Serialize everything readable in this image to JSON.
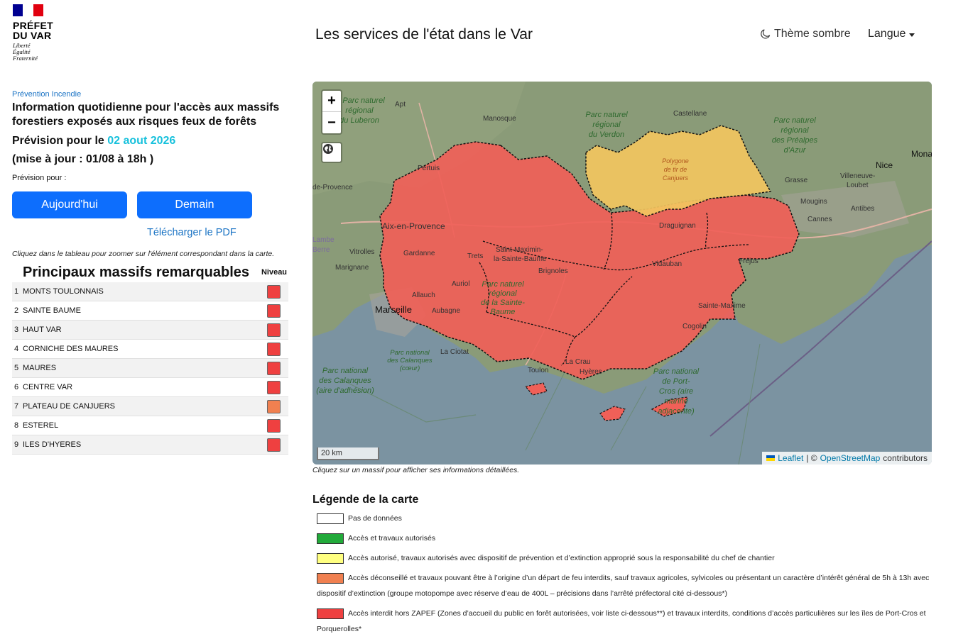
{
  "logo": {
    "line1": "PRÉFET",
    "line2": "DU VAR",
    "motto1": "Liberté",
    "motto2": "Égalité",
    "motto3": "Fraternité",
    "flag_colors": [
      "#000091",
      "#ffffff",
      "#e1000f"
    ]
  },
  "header": {
    "title": "Les services de l'état dans le Var",
    "theme_label": "Thème sombre",
    "theme_icon": "moon-icon",
    "lang_label": "Langue"
  },
  "prevention": {
    "category": "Prévention Incendie",
    "title": "Information quotidienne pour l'accès aux massifs forestiers exposés aux risques feux de forêts",
    "forecast_prefix": "Prévision pour le",
    "forecast_date": "02 aout 2026",
    "update": "(mise à jour : 01/08 à 18h )",
    "forecast_label": "Prévision pour :",
    "btn_today": "Aujourd'hui",
    "btn_tomorrow": "Demain",
    "pdf_link": "Télécharger le PDF",
    "hint": "Cliquez dans le tableau pour zoomer sur l'élément correspondant dans la carte."
  },
  "massifs": {
    "title": "Principaux massifs remarquables",
    "level_header": "Niveau",
    "rows": [
      {
        "num": "1",
        "name": "MONTS TOULONNAIS",
        "color": "#ef4040"
      },
      {
        "num": "2",
        "name": "SAINTE BAUME",
        "color": "#ef4040"
      },
      {
        "num": "3",
        "name": "HAUT VAR",
        "color": "#ef4040"
      },
      {
        "num": "4",
        "name": "CORNICHE DES MAURES",
        "color": "#ef4040"
      },
      {
        "num": "5",
        "name": "MAURES",
        "color": "#ef4040"
      },
      {
        "num": "6",
        "name": "CENTRE VAR",
        "color": "#ef4040"
      },
      {
        "num": "7",
        "name": "PLATEAU DE CANJUERS",
        "color": "#f08050"
      },
      {
        "num": "8",
        "name": "ESTEREL",
        "color": "#ef4040"
      },
      {
        "num": "9",
        "name": "ILES D'HYERES",
        "color": "#ef4040"
      }
    ]
  },
  "map": {
    "zoom_in": "+",
    "zoom_out": "−",
    "scale": "20 km",
    "attrib_leaflet": "Leaflet",
    "attrib_sep": "| ©",
    "attrib_osm": "OpenStreetMap",
    "attrib_contrib": "contributors",
    "caption": "Cliquez sur un massif pour afficher ses informations détaillées.",
    "labels": {
      "apt": "Apt",
      "manosque": "Manosque",
      "castellane": "Castellane",
      "pertuis": "Pertuis",
      "aix": "Aix-en-Provence",
      "vitrolles": "Vitrolles",
      "gardanne": "Gardanne",
      "trets": "Trets",
      "marignane": "Marignane",
      "marseille": "Marseille",
      "aubagne": "Aubagne",
      "laciotat": "La Ciotat",
      "allauch": "Allauch",
      "auriol": "Auriol",
      "grasse": "Grasse",
      "nice": "Nice",
      "cannes": "Cannes",
      "antibes": "Antibes",
      "mougins": "Mougins",
      "villeneuve": "Villeneuve-",
      "loubet": "Loubet",
      "draguignan": "Draguignan",
      "vidauban": "Vidauban",
      "frejus": "Fréjus",
      "saintemaxime": "Sainte-Maxime",
      "cogolin": "Cogolin",
      "toulon": "Toulon",
      "lacrau": "La Crau",
      "hyeres": "Hyères",
      "brignoles": "Brignoles",
      "stmaximin": "Saint-Maximin-",
      "stmaximin2": "la-Sainte-Baume",
      "mona": "Mona",
      "provence": "de-Provence",
      "lambe": "Lambe",
      "berre": "Berre",
      "luberon1": "Parc naturel",
      "luberon2": "régional",
      "luberon3": "du Luberon",
      "verdon1": "Parc naturel",
      "verdon2": "régional",
      "verdon3": "du Verdon",
      "prealpes1": "Parc naturel",
      "prealpes2": "régional",
      "prealpes3": "des Préalpes",
      "prealpes4": "d'Azur",
      "canjuers1": "Polygone",
      "canjuers2": "de tir de",
      "canjuers3": "Canjuers",
      "sbaume1": "Parc naturel",
      "sbaume2": "régional",
      "sbaume3": "de la Sainte-",
      "sbaume4": "Baume",
      "calanques1": "Parc national",
      "calanques2": "des Calanques",
      "calanques3": "(cœur)",
      "calanquesadh1": "Parc national",
      "calanquesadh2": "des Calanques",
      "calanquesadh3": "(aire d'adhésion)",
      "portcros1": "Parc national",
      "portcros2": "de Port-",
      "portcros3": "Cros (aire",
      "portcros4": "marine",
      "portcros5": "adjacente)"
    }
  },
  "legend": {
    "title": "Légende de la carte",
    "items": [
      {
        "color": "#ffffff",
        "text": "Pas de données"
      },
      {
        "color": "#22aa3a",
        "text": "Accès et travaux autorisés"
      },
      {
        "color": "#ffff80",
        "text": "Accès autorisé, travaux autorisés avec dispositif de prévention et d’extinction approprié sous la responsabilité du chef de chantier"
      },
      {
        "color": "#f08050",
        "text": "Accès déconseillé et travaux pouvant être à l’origine d’un départ de feu interdits, sauf travaux agricoles, sylvicoles ou présentant un caractère d’intérêt général de 5h à 13h avec dispositif d’extinction (groupe motopompe avec réserve d’eau de 400L – précisions dans l’arrêté préfectoral cité ci-dessous*)"
      },
      {
        "color": "#ef4040",
        "text": "Accès interdit hors ZAPEF (Zones d’accueil du public en forêt autorisées, voir liste ci-dessous**) et travaux interdits, conditions d’accès particulières sur les îles de Port-Cros et Porquerolles*"
      }
    ]
  }
}
